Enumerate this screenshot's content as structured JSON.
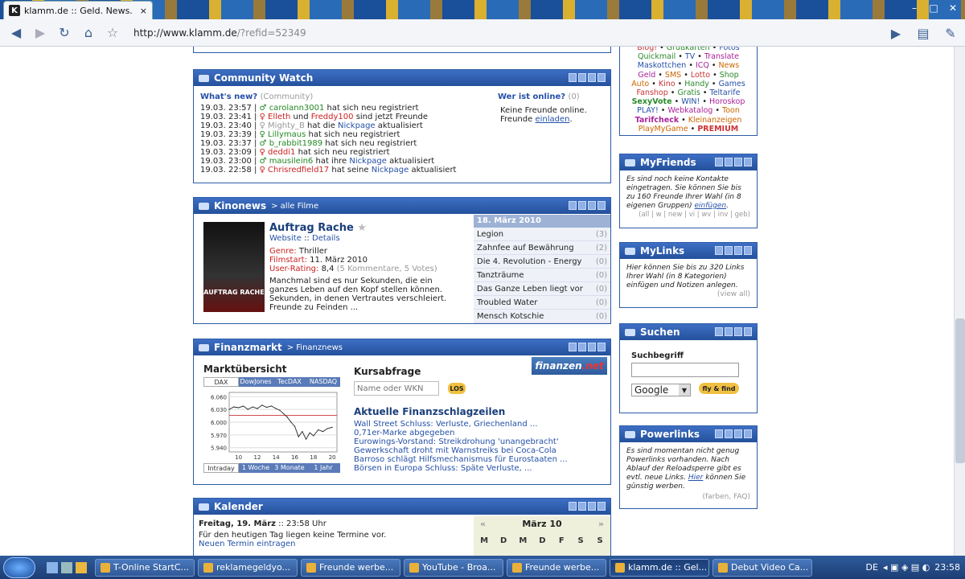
{
  "browser": {
    "tab_title": "klamm.de :: Geld. News. ...",
    "url_host": "http://www.klamm.de",
    "url_path": "/?refid=52349",
    "close": "×"
  },
  "community": {
    "title": "Community Watch",
    "whats_new": "What's new?",
    "whats_new_tag": "(Community)",
    "entries": [
      {
        "time": "19.03. 23:57 |",
        "user": "carolann3001",
        "text": " hat sich neu registriert",
        "color": "grn"
      },
      {
        "time": "19.03. 23:41 |",
        "user": "Elleth",
        "text": " und ",
        "user2": "Freddy100",
        "text2": " sind jetzt Freunde",
        "color": "red"
      },
      {
        "time": "19.03. 23:40 |",
        "user": "Mighty_B",
        "text": " hat die ",
        "user2": "Nickpage",
        "text2": " aktualisiert",
        "color": "gray"
      },
      {
        "time": "19.03. 23:39 |",
        "user": "Lillymaus",
        "text": " hat sich neu registriert",
        "color": "grn"
      },
      {
        "time": "19.03. 23:37 |",
        "user": "b_rabbit1989",
        "text": " hat sich neu registriert",
        "color": "grn"
      },
      {
        "time": "19.03. 23:09 |",
        "user": "deddi1",
        "text": " hat sich neu registriert",
        "color": "red"
      },
      {
        "time": "19.03. 23:00 |",
        "user": "mausilein6",
        "text": " hat ihre ",
        "user2": "Nickpage",
        "text2": " aktualisiert",
        "color": "grn"
      },
      {
        "time": "19.03. 22:58 |",
        "user": "Chrisredfield17",
        "text": " hat seine ",
        "user2": "Nickpage",
        "text2": " aktualisiert",
        "color": "red"
      }
    ],
    "online_title": "Wer ist online?",
    "online_count": "(0)",
    "online_text": "Keine Freunde online.",
    "invite_prefix": "Freunde ",
    "invite_link": "einladen",
    "invite_suffix": "."
  },
  "kino": {
    "title": "Kinonews",
    "sub": "> alle Filme",
    "movie_title": "Auftrag Rache",
    "poster_text": "AUFTRAG RACHE",
    "website": "Website",
    "sep": "::",
    "details": "Details",
    "genre_label": "Genre:",
    "genre": "Thriller",
    "start_label": "Filmstart:",
    "start": "11. März 2010",
    "rating_label": "User-Rating:",
    "rating": "8,4",
    "rating_meta": "(5 Kommentare, 5 Votes)",
    "desc": "Manchmal sind es nur Sekunden, die ein ganzes Leben auf den Kopf stellen können. Sekunden, in denen Vertrautes verschleiert. Freunde zu Feinden ...",
    "list_date": "18. März 2010",
    "list": [
      {
        "name": "Legion",
        "count": "(3)"
      },
      {
        "name": "Zahnfee auf Bewährung",
        "count": "(2)"
      },
      {
        "name": "Die 4. Revolution - Energy",
        "count": "(0)"
      },
      {
        "name": "Tanzträume",
        "count": "(0)"
      },
      {
        "name": "Das Ganze Leben liegt vor",
        "count": "(0)"
      },
      {
        "name": "Troubled Water",
        "count": "(0)"
      },
      {
        "name": "Mensch Kotschie",
        "count": "(0)"
      }
    ]
  },
  "finanz": {
    "title": "Finanzmarkt",
    "sub": "> Finanznews",
    "market_title": "Marktübersicht",
    "tabs": [
      "DAX",
      "DowJones",
      "TecDAX",
      "NASDAQ"
    ],
    "periods": [
      "Intraday",
      "1 Woche",
      "3 Monate",
      "1 Jahr"
    ],
    "logo_main": "finanzen",
    "logo_net": ".net",
    "kurs_title": "Kursabfrage",
    "kurs_placeholder": "Name oder WKN",
    "los": "LOS",
    "news_title": "Aktuelle Finanzschlagzeilen",
    "news": [
      "Wall Street Schluss: Verluste, Griechenland ...",
      "0,71er-Marke abgegeben",
      "Eurowings-Vorstand: Streikdrohung 'unangebracht'",
      "Gewerkschaft droht mit Warnstreiks bei Coca-Cola",
      "Barroso schlägt Hilfsmechanismus für Eurostaaten ...",
      "Börsen in Europa Schluss: Späte Verluste, ..."
    ]
  },
  "chart_data": {
    "type": "line",
    "title": "",
    "xlabel": "",
    "ylabel": "",
    "x_ticks": [
      "10",
      "12",
      "14",
      "16",
      "18",
      "20"
    ],
    "y_ticks": [
      "6.060",
      "6.030",
      "6.000",
      "5.970",
      "5.940"
    ],
    "ylim": [
      5930,
      6070
    ],
    "xlim": [
      9,
      20.5
    ],
    "reference_line": 6016,
    "series": [
      {
        "x": [
          9,
          9.5,
          10,
          10.5,
          11,
          11.5,
          12,
          12.5,
          13,
          13.5,
          14,
          14.4,
          14.8,
          15.2,
          15.6,
          16,
          16.4,
          16.8,
          17.2,
          17.6,
          18,
          18.5,
          19,
          19.5,
          20
        ],
        "values": [
          6030,
          6036,
          6034,
          6038,
          6030,
          6036,
          6032,
          6040,
          6035,
          6038,
          6032,
          6028,
          6020,
          6012,
          6000,
          5990,
          5966,
          5978,
          5960,
          5975,
          5968,
          5982,
          5978,
          5985,
          5988
        ]
      }
    ]
  },
  "kalender": {
    "title": "Kalender",
    "date": "Freitag, 19. März",
    "time": ":: 23:58 Uhr",
    "no_events": "Für den heutigen Tag liegen keine Termine vor.",
    "new_event": "Neuen Termin eintragen",
    "month": "März 10",
    "prev": "«",
    "next": "»",
    "days": [
      "M",
      "D",
      "M",
      "D",
      "F",
      "S",
      "S"
    ]
  },
  "right_top": {
    "lines": [
      [
        "Blog!",
        "Grußkarten",
        "Fotos"
      ],
      [
        "Quickmail",
        "TV",
        "Translate"
      ],
      [
        "Maskottchen",
        "ICQ",
        "News"
      ],
      [
        "Geld",
        "SMS",
        "Lotto",
        "Shop"
      ],
      [
        "Auto",
        "Kino",
        "Handy",
        "Games"
      ],
      [
        "Fanshop",
        "Gratis",
        "Teltarife"
      ],
      [
        "SexyVote",
        "WIN!",
        "Horoskop"
      ],
      [
        "PLAY!",
        "Webkatalog",
        "Toon"
      ],
      [
        "Tarifcheck",
        "Kleinanzeigen"
      ],
      [
        "PlayMyGame",
        "PREMIUM"
      ]
    ]
  },
  "myfriends": {
    "title": "MyFriends",
    "text": "Es sind noch keine Kontakte eingetragen. Sie können Sie bis zu 160 Freunde Ihrer Wahl (in 8 eigenen Gruppen) ",
    "link": "einfügen",
    "suffix": ".",
    "filters": "(all | w | new | vi | wv | inv | geb)"
  },
  "mylinks": {
    "title": "MyLinks",
    "text": "Hier können Sie bis zu 320 Links Ihrer Wahl (in 8 Kategorien) einfügen und Notizen anlegen.",
    "viewall": "(view all)"
  },
  "suchen": {
    "title": "Suchen",
    "label": "Suchbegriff",
    "engine": "Google",
    "button": "fly & find"
  },
  "powerlinks": {
    "title": "Powerlinks",
    "text": "Es sind momentan nicht genug Powerlinks vorhanden. Nach Ablauf der Reloadsperre gibt es evtl. neue Links. ",
    "link": "Hier",
    "text2": " können Sie günstig werben.",
    "faq": "(farben, FAQ)"
  },
  "taskbar": {
    "items": [
      "T-Online StartC...",
      "reklamegeldyo...",
      "Freunde werbe...",
      "YouTube - Broa...",
      "Freunde werbe...",
      "klamm.de :: Gel...",
      "Debut Video Ca..."
    ],
    "lang": "DE",
    "clock": "23:58"
  }
}
